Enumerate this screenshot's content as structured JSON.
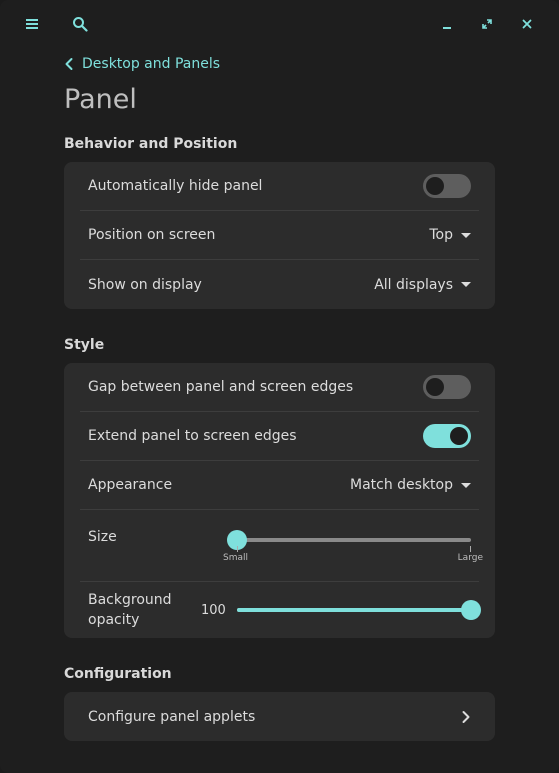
{
  "icons": {
    "menu": "hamburger-icon",
    "search": "search-icon",
    "minimize": "minimize-icon",
    "maximize": "maximize-icon",
    "close": "close-icon",
    "back": "chevron-left-icon",
    "forward": "chevron-right-icon"
  },
  "colors": {
    "accent": "#7fe0dc",
    "background": "#1e1e1e",
    "card": "#2c2c2c",
    "toggle_off": "#5e5e5e"
  },
  "breadcrumb": {
    "back_label": "Desktop and Panels"
  },
  "page": {
    "title": "Panel"
  },
  "behavior": {
    "title": "Behavior and Position",
    "autohide": {
      "label": "Automatically hide panel",
      "on": false
    },
    "position": {
      "label": "Position on screen",
      "value": "Top"
    },
    "display": {
      "label": "Show on display",
      "value": "All displays"
    }
  },
  "style": {
    "title": "Style",
    "gap": {
      "label": "Gap between panel and screen edges",
      "on": false
    },
    "extend": {
      "label": "Extend panel to screen edges",
      "on": true
    },
    "appearance": {
      "label": "Appearance",
      "value": "Match desktop"
    },
    "size": {
      "label": "Size",
      "value_fraction": 0.0,
      "min_label": "Small",
      "max_label": "Large"
    },
    "opacity": {
      "label": "Background opacity",
      "value": "100",
      "value_fraction": 1.0
    }
  },
  "configuration": {
    "title": "Configuration",
    "applets": {
      "label": "Configure panel applets"
    }
  }
}
